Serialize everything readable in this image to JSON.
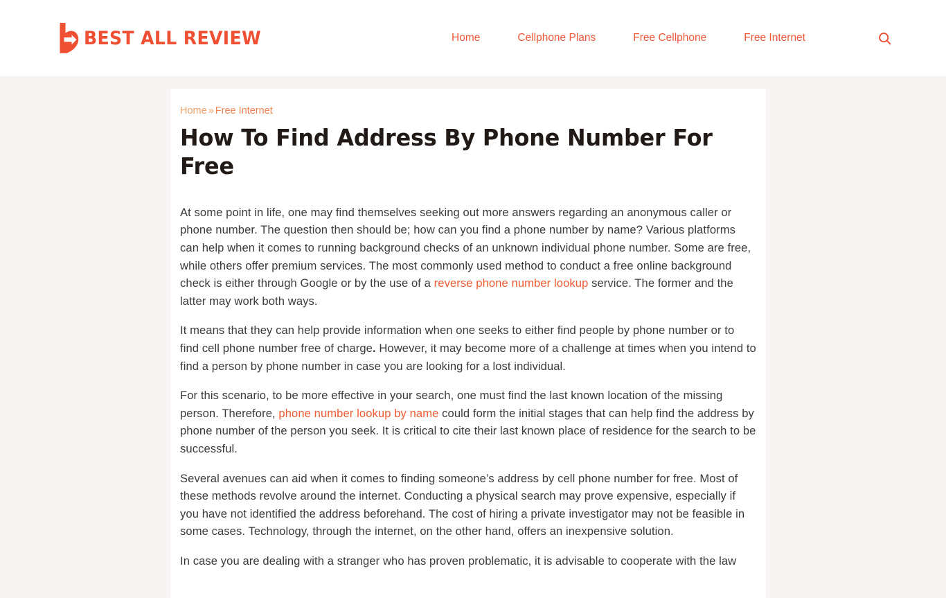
{
  "site": {
    "logo_text": "BEST ALL REVIEW",
    "logo_icon": "b-arrow-logomark",
    "accent_color": "#ef5033",
    "body_text_color": "#3b3b3b",
    "page_bg_color": "#f8f4f3",
    "card_bg_color": "#ffffff"
  },
  "nav": {
    "items": [
      {
        "label": "Home"
      },
      {
        "label": "Cellphone Plans"
      },
      {
        "label": "Free Cellphone"
      },
      {
        "label": "Free Internet"
      }
    ],
    "search_icon": "search-icon"
  },
  "breadcrumb": {
    "home": "Home",
    "separator": "»",
    "current": "Free Internet"
  },
  "article": {
    "title": "How To Find Address By Phone Number For Free",
    "paragraphs": [
      {
        "parts": [
          {
            "type": "text",
            "value": "At some point in life, one may find themselves seeking out more answers regarding an anonymous caller or phone number. The question then should be; how can you find a phone number by name? Various platforms can help when it comes to running background checks of an unknown individual phone number. Some are free, while others offer premium services. The most commonly used method to conduct a free online background check is either through Google or by the use of a "
          },
          {
            "type": "link",
            "value": "reverse phone number lookup"
          },
          {
            "type": "text",
            "value": " service. The former and the latter may work both ways."
          }
        ]
      },
      {
        "parts": [
          {
            "type": "text",
            "value": "It means that they can help provide information when one seeks to either find people by phone number or to find cell phone number free of charge"
          },
          {
            "type": "bold",
            "value": "."
          },
          {
            "type": "text",
            "value": " However, it may become more of a challenge at times when you intend to find a person by phone number in case you are looking for a lost individual."
          }
        ]
      },
      {
        "parts": [
          {
            "type": "text",
            "value": "For this scenario, to be more effective in your search, one must find the last known location of the missing person. Therefore, "
          },
          {
            "type": "link",
            "value": "phone number lookup by name"
          },
          {
            "type": "text",
            "value": " could form the initial stages that can help find the address by phone number of the person you seek. It is critical to cite their last known place of residence for the search to be successful."
          }
        ]
      },
      {
        "parts": [
          {
            "type": "text",
            "value": "Several avenues can aid when it comes to finding someone’s address by cell phone number for free. Most of these methods revolve around the internet. Conducting a physical search may prove expensive, especially if you have not identified the address beforehand. The cost of hiring a private investigator may not be feasible in some cases. Technology, through the internet, on the other hand, offers an inexpensive solution."
          }
        ]
      },
      {
        "parts": [
          {
            "type": "text",
            "value": "In case you are dealing with a stranger who has proven problematic, it is advisable to cooperate with the law"
          }
        ]
      }
    ]
  }
}
